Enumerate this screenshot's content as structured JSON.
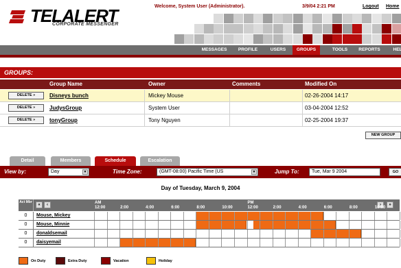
{
  "app": {
    "logo": "TELALERT",
    "subtitle": "CORPORATE MESSENGER"
  },
  "topbar": {
    "welcome": "Welcome, System User (Administrator).",
    "datetime": "3/9/04 2:21 PM",
    "logout": "Logout",
    "home": "Home"
  },
  "colors": {
    "brand_red": "#b80d0d",
    "dark_red": "#8a0000",
    "on_duty": "#ef6a14",
    "extra_duty": "#5a0a0a",
    "vacation": "#8a0000",
    "holiday": "#f5c20a"
  },
  "nav": [
    "MESSAGES",
    "PROFILE",
    "USERS",
    "GROUPS",
    "TOOLS",
    "REPORTS",
    "HEL"
  ],
  "nav_active": "GROUPS",
  "groups": {
    "title": "GROUPS:",
    "headers": [
      "Group Name",
      "Owner",
      "Comments",
      "Modified On"
    ],
    "delete_label": "DELETE »",
    "new_group_label": "NEW GROUP",
    "rows": [
      {
        "name": "Disneys bunch",
        "owner": "Mickey Mouse",
        "comments": "",
        "modified": "02-26-2004 14:17"
      },
      {
        "name": "JudysGroup",
        "owner": "System User",
        "comments": "",
        "modified": "03-04-2004 12:52"
      },
      {
        "name": "tonyGroup",
        "owner": "Tony Nguyen",
        "comments": "",
        "modified": "02-25-2004 19:37"
      }
    ]
  },
  "tabs": [
    "Detail",
    "Members",
    "Schedule",
    "Escalation"
  ],
  "tab_active": "Schedule",
  "filters": {
    "view_by_label": "View by:",
    "view_by_value": "Day",
    "timezone_label": "Time Zone:",
    "timezone_value": "(GMT-08:00) Pacific Time (US",
    "jump_label": "Jump To:",
    "jump_value": "Tue, Mar 9 2004",
    "go_label": "GO"
  },
  "schedule": {
    "title": "Day of Tuesday, March 9, 2004",
    "acts_label": "Act Mbr",
    "am_label": "AM",
    "pm_label": "PM",
    "hours": [
      "12:00",
      "2:00",
      "4:00",
      "6:00",
      "8:00",
      "10:00",
      "12:00",
      "2:00",
      "4:00",
      "6:00",
      "8:00",
      "10:00"
    ],
    "rows": [
      {
        "count": "0",
        "name": "Mouse, Mickey",
        "blocks": [
          [
            8,
            18
          ]
        ]
      },
      {
        "count": "0",
        "name": "Mouse, Minnie",
        "blocks": [
          [
            8,
            12
          ],
          [
            12.5,
            19
          ]
        ]
      },
      {
        "count": "0",
        "name": "donaldsemail",
        "blocks": [
          [
            17,
            21
          ]
        ]
      },
      {
        "count": "0",
        "name": "daisyemail",
        "blocks": [
          [
            2,
            8
          ]
        ]
      }
    ]
  },
  "legend": [
    {
      "label": "On Duty",
      "color": "#ef6a14"
    },
    {
      "label": "Extra Duty",
      "color": "#5a0a0a"
    },
    {
      "label": "Vacation",
      "color": "#8a0000"
    },
    {
      "label": "Holiday",
      "color": "#f5c20a"
    }
  ]
}
